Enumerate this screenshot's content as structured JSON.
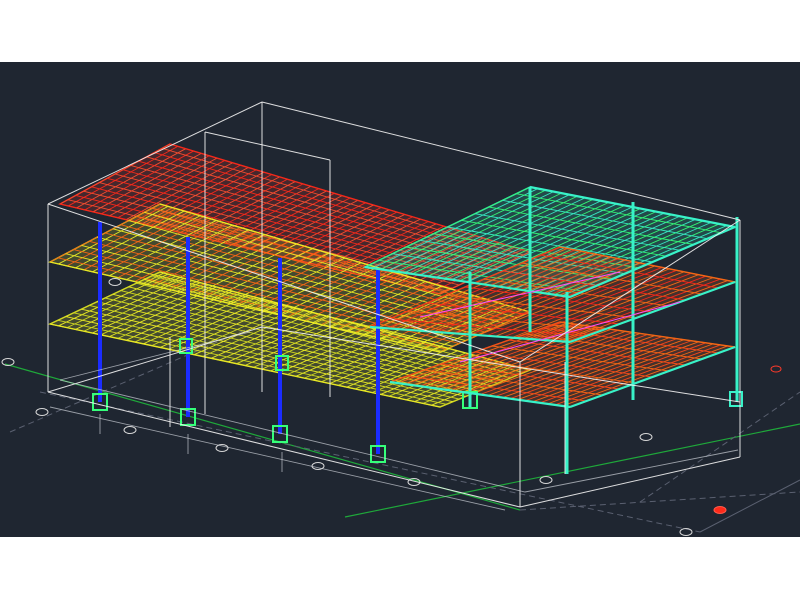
{
  "viewport": {
    "background_color": "#1f2631",
    "grid_axis_color": "#1fa83a",
    "boundary_color": "#f2f2f2",
    "axis_line_color": "#8a8f99"
  },
  "model_colors": {
    "red": "#ff2a1a",
    "orange": "#ff6a14",
    "yellow": "#f2f225",
    "lime": "#b6ff2e",
    "green": "#35ff7a",
    "cyan": "#38f2c8",
    "blue": "#1b2cff",
    "magenta": "#ff4dff"
  },
  "grid_marker_icon": "circle-grid-bubble-icon",
  "highlight_marker_icon": "red-grid-bubble-icon"
}
